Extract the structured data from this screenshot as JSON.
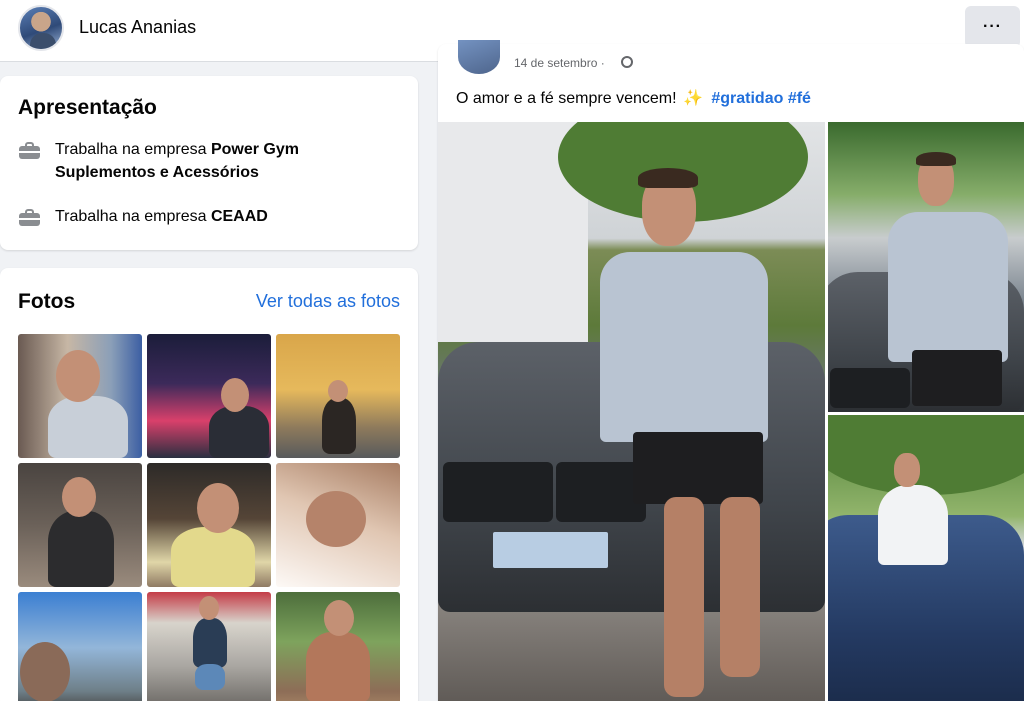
{
  "header": {
    "profile_name": "Lucas Ananias",
    "more_label": "···"
  },
  "intro": {
    "title": "Apresentação",
    "items": [
      {
        "prefix": "Trabalha na empresa ",
        "company": "Power Gym Suplementos e Acessórios",
        "icon": "briefcase-icon"
      },
      {
        "prefix": "Trabalha na empresa ",
        "company": "CEAAD",
        "icon": "briefcase-icon"
      }
    ]
  },
  "photos": {
    "title": "Fotos",
    "see_all": "Ver todas as fotos",
    "count": 9
  },
  "post": {
    "time": "14 de setembro ·",
    "text": "O amor e a fé sempre vencem!",
    "sparkle": "✨",
    "hashtags": [
      "#gratidao",
      "#fé"
    ]
  },
  "colors": {
    "link": "#216fdb",
    "background": "#f0f2f5",
    "card": "#ffffff",
    "button": "#e4e6eb"
  }
}
